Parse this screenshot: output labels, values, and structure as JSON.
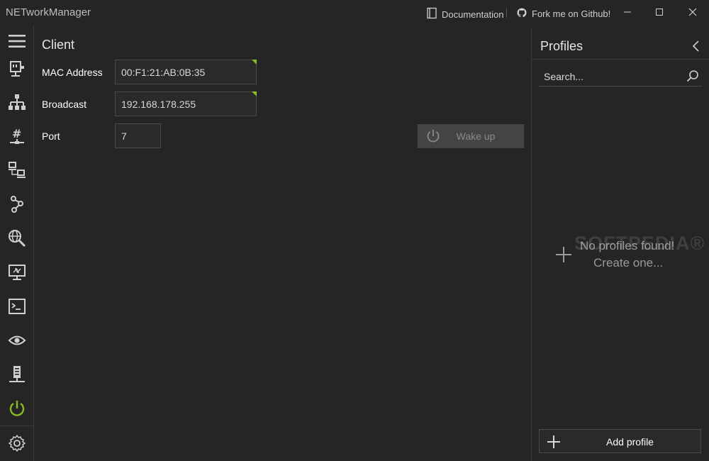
{
  "app": {
    "title": "NETworkManager"
  },
  "titlebar": {
    "documentation_label": "Documentation",
    "github_label": "Fork me on Github!"
  },
  "sidebar": {
    "items": [
      {
        "icon": "hamburger-menu-icon"
      },
      {
        "icon": "network-interface-icon"
      },
      {
        "icon": "ip-scanner-icon"
      },
      {
        "icon": "subnet-calculator-icon"
      },
      {
        "icon": "port-scanner-icon"
      },
      {
        "icon": "traceroute-icon"
      },
      {
        "icon": "dns-lookup-icon"
      },
      {
        "icon": "remote-desktop-icon"
      },
      {
        "icon": "terminal-icon"
      },
      {
        "icon": "eye-icon"
      },
      {
        "icon": "server-icon"
      },
      {
        "icon": "wake-on-lan-icon",
        "active": true
      },
      {
        "icon": "gear-icon"
      }
    ],
    "active_color": "#8bbd20"
  },
  "main": {
    "title": "Client",
    "fields": {
      "mac_label": "MAC Address",
      "mac_value": "00:F1:21:AB:0B:35",
      "broadcast_label": "Broadcast",
      "broadcast_value": "192.168.178.255",
      "port_label": "Port",
      "port_value": "7"
    },
    "wake_button_label": "Wake up"
  },
  "profiles": {
    "title": "Profiles",
    "search_placeholder": "Search...",
    "empty_line1": "No profiles found!",
    "empty_line2": "Create one...",
    "add_profile_label": "Add profile",
    "watermark": "SOFTPEDIA®"
  },
  "colors": {
    "background": "#252525",
    "accent": "#8bbd20",
    "border": "#3a3a3a"
  }
}
